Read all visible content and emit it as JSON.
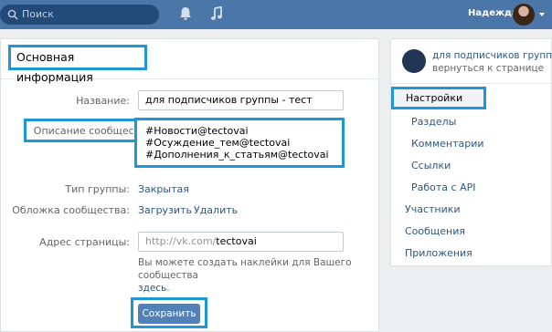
{
  "topbar": {
    "search_placeholder": "Поиск",
    "username": "Надежда",
    "colors": {
      "bar": "#4a76a8",
      "search": "#224b7a"
    },
    "icons": [
      "search-icon",
      "bell-icon",
      "music-icon",
      "chevron-down-icon"
    ]
  },
  "main": {
    "title": "Основная информация",
    "fields": {
      "name_label": "Название:",
      "name_value": "для подписчиков группы - тест",
      "description_label": "Описание сообщества:",
      "description_lines": [
        "#Новости@tectovai",
        "#Осуждение_тем@tectovai",
        "#Дополнения_к_статьям@tectovai"
      ],
      "group_type_label": "Тип группы:",
      "group_type_value": "Закрытая",
      "cover_label": "Обложка сообщества:",
      "cover_upload": "Загрузить",
      "cover_sep": "·",
      "cover_delete": "Удалить",
      "address_label": "Адрес страницы:",
      "address_prefix": "http://vk.com/",
      "address_value": "tectovai",
      "hint_text": "Вы можете создать наклейки для Вашего сообщества",
      "hint_link": "здесь",
      "hint_end": "."
    },
    "save_label": "Сохранить"
  },
  "sidebar": {
    "group_name": "для подписчиков группы...",
    "back_link": "вернуться к странице",
    "settings": "Настройки",
    "sub_items": [
      "Разделы",
      "Комментарии",
      "Ссылки",
      "Работа с API"
    ],
    "items": [
      "Участники",
      "Сообщения",
      "Приложения"
    ]
  },
  "accent": {
    "highlight": "#1f97d6",
    "link": "#2a5885",
    "button": "#5181b8"
  }
}
